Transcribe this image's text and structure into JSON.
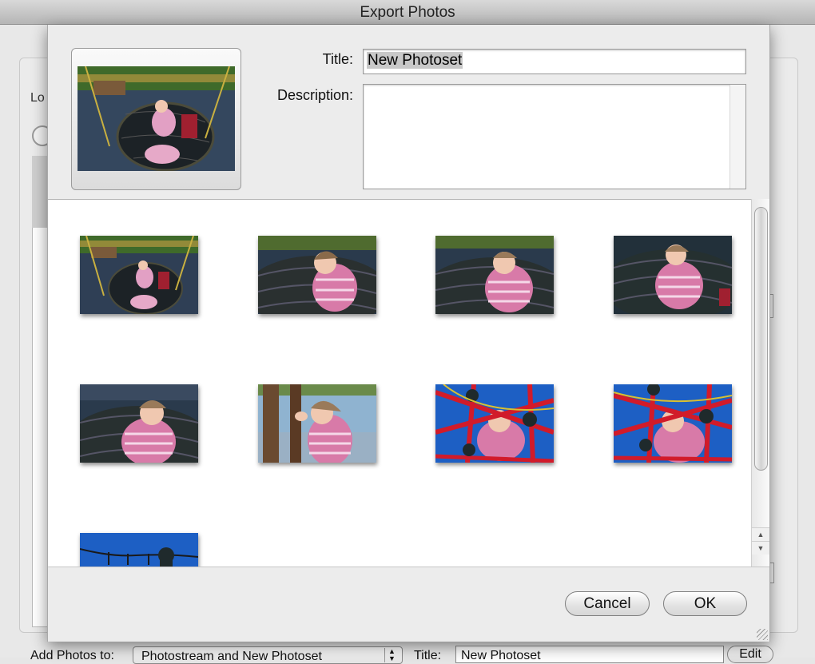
{
  "window": {
    "title": "Export Photos"
  },
  "background": {
    "left_label_fragment": "Lo",
    "add_photos_label": "Add Photos to:",
    "add_photos_value": "Photostream and New Photoset",
    "title_label": "Title:",
    "title_value": "New Photoset",
    "edit_label": "Edit"
  },
  "sheet": {
    "title_label": "Title:",
    "title_value": "New Photoset",
    "description_label": "Description:",
    "description_value": "",
    "cancel_label": "Cancel",
    "ok_label": "OK"
  },
  "thumbnails": [
    {
      "kind": "swing-wide"
    },
    {
      "kind": "child-in-net"
    },
    {
      "kind": "child-in-net"
    },
    {
      "kind": "child-in-net"
    },
    {
      "kind": "child-in-net"
    },
    {
      "kind": "child-by-pole"
    },
    {
      "kind": "red-climbing-net"
    },
    {
      "kind": "red-climbing-net"
    },
    {
      "kind": "blue-sky-rope"
    }
  ],
  "colors": {
    "sky_blue": "#1d5fc4",
    "jacket_pink": "#d87aa8",
    "net_red": "#d11b2a",
    "net_dark": "#1f2a2c"
  }
}
